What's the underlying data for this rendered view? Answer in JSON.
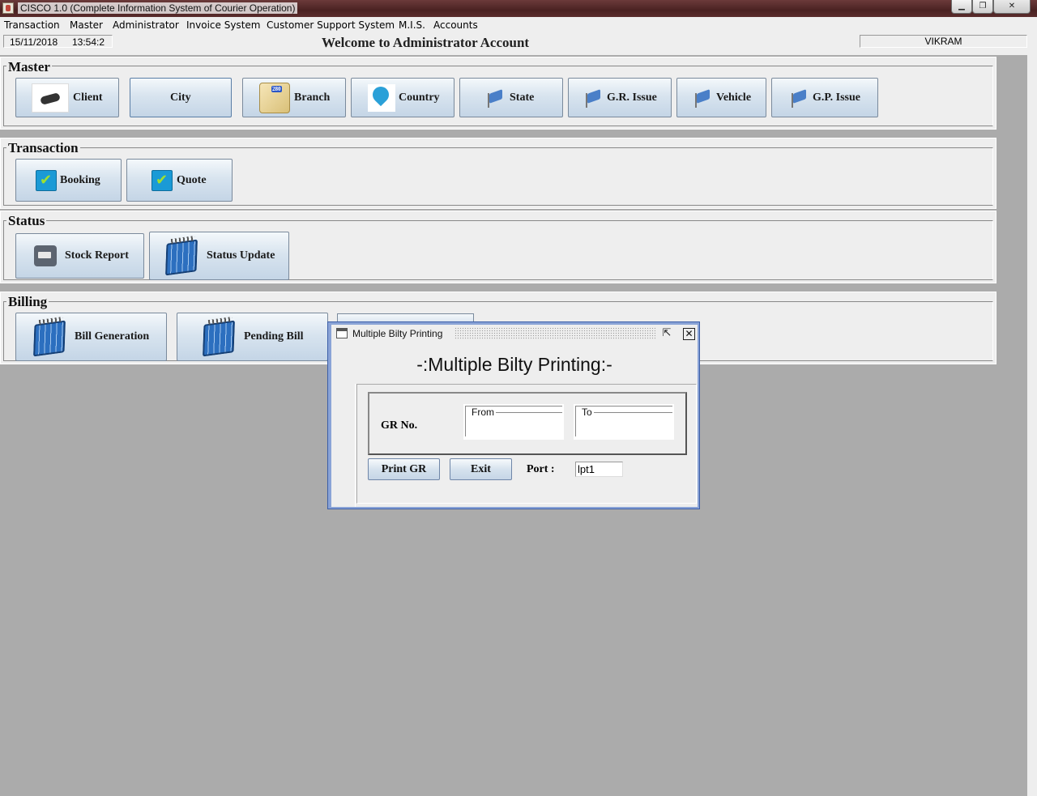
{
  "window": {
    "title": "CISCO 1.0 (Complete Information System of Courier Operation)",
    "controls": {
      "minimize": "▁",
      "maximize": "❐",
      "close": "✕"
    }
  },
  "menu": [
    "Transaction",
    "Master",
    "Administrator",
    "Invoice System",
    "Customer Support System",
    "M.I.S.",
    "Accounts"
  ],
  "header": {
    "date": "15/11/2018",
    "time": "13:54:2",
    "welcome": "Welcome to Administrator Account",
    "user": "VIKRAM"
  },
  "sections": {
    "master": {
      "title": "Master",
      "buttons": [
        "Client",
        "City",
        "Branch",
        "Country",
        "State",
        "G.R. Issue",
        "Vehicle",
        "G.P. Issue"
      ],
      "icons": [
        "handshake-icon",
        "",
        "map-icon",
        "location-pin-icon",
        "flag-icon",
        "flag-icon",
        "flag-icon",
        "flag-icon"
      ]
    },
    "transaction": {
      "title": "Transaction",
      "buttons": [
        "Booking",
        "Quote"
      ],
      "icons": [
        "checkbox-icon",
        "checkbox-icon"
      ]
    },
    "status": {
      "title": "Status",
      "buttons": [
        "Stock Report",
        "Status Update"
      ],
      "icons": [
        "truck-icon",
        "calendar-icon"
      ]
    },
    "billing": {
      "title": "Billing",
      "buttons": [
        "Bill Generation",
        "Pending Bill"
      ],
      "icons": [
        "calendar-icon",
        "calendar-icon"
      ]
    }
  },
  "dialog": {
    "title": "Multiple Bilty Printing",
    "heading": "-:Multiple Bilty Printing:-",
    "gr_label": "GR No.",
    "from_label": "From",
    "to_label": "To",
    "from_value": "",
    "to_value": "",
    "print_button": "Print GR",
    "exit_button": "Exit",
    "port_label": "Port :",
    "port_value": "lpt1",
    "minimize_glyph": "⇱",
    "close_glyph": "✕"
  }
}
